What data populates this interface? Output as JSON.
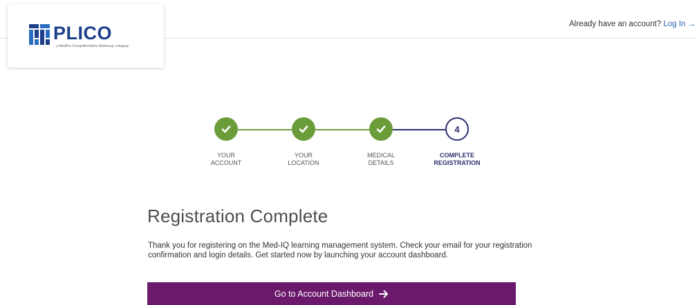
{
  "header": {
    "logo_text": "PLICO",
    "logo_tagline": "a MedPro Group/Berkshire Hathaway company",
    "login_prompt": "Already have an account?",
    "login_link": "Log In",
    "login_arrow_icon": "arrow-right-icon"
  },
  "stepper": {
    "steps": [
      {
        "line1": "YOUR",
        "line2": "ACCOUNT",
        "status": "complete",
        "icon": "check-icon"
      },
      {
        "line1": "YOUR",
        "line2": "LOCATION",
        "status": "complete",
        "icon": "check-icon"
      },
      {
        "line1": "MEDICAL",
        "line2": "DETAILS",
        "status": "complete",
        "icon": "check-icon"
      },
      {
        "line1": "COMPLETE",
        "line2": "REGISTRATION",
        "status": "current",
        "number": "4"
      }
    ]
  },
  "main": {
    "title": "Registration Complete",
    "body": "Thank you for registering on the Med-IQ learning management system. Check your email for your registration confirmation and login details. Get started now by launching your account dashboard.",
    "button_label": "Go to Account Dashboard",
    "button_icon": "arrow-right-icon"
  },
  "colors": {
    "step_complete": "#6b9c3a",
    "step_current": "#2b2e6f",
    "button_bg": "#6b1a6b",
    "link": "#2a5fb5",
    "logo_blue": "#1d3f8a"
  }
}
